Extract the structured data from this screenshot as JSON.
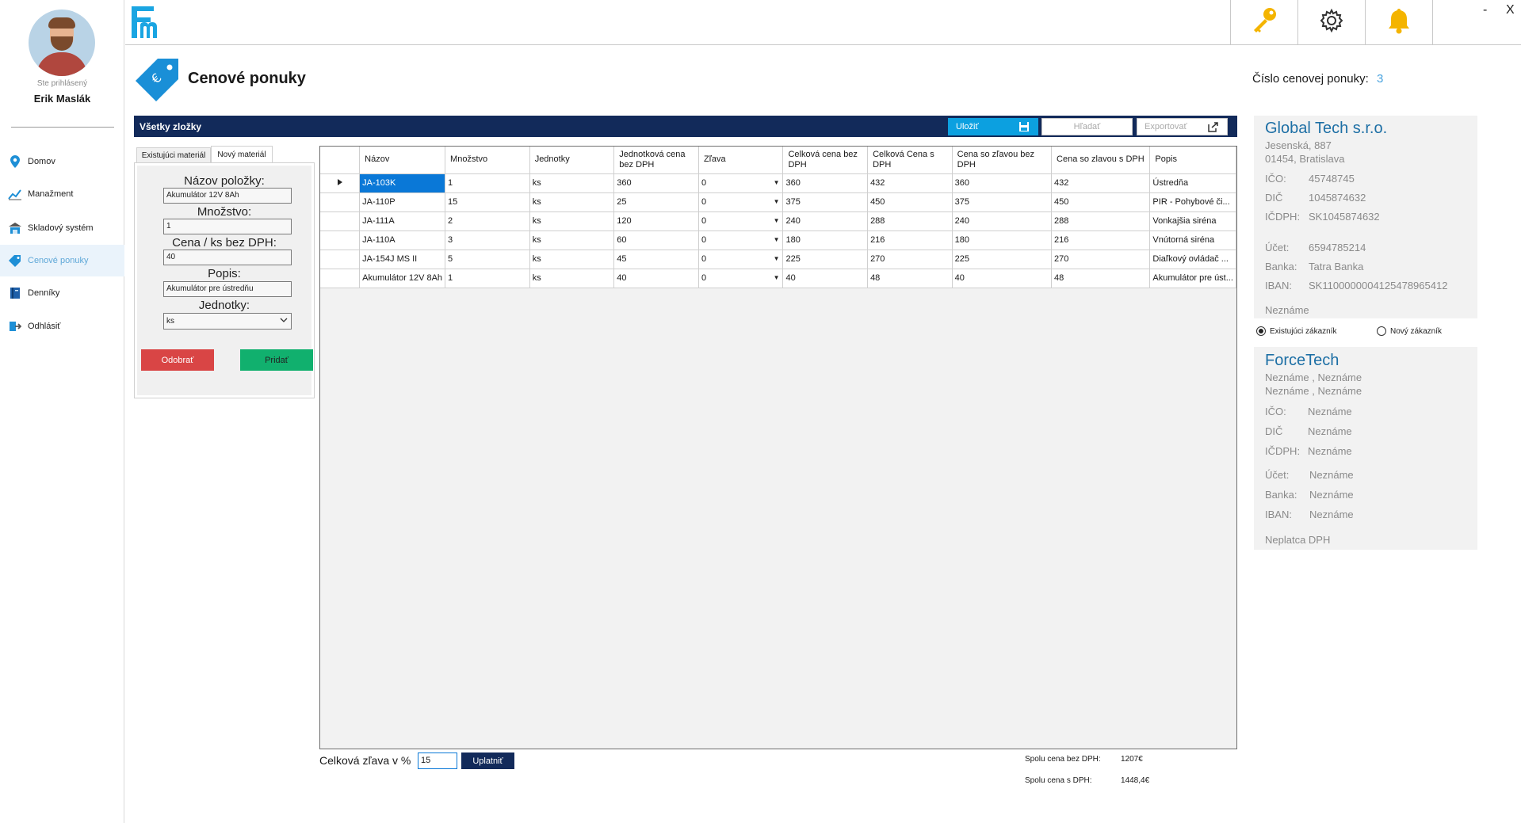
{
  "user": {
    "logged_label": "Ste prihlásený",
    "name": "Erik Maslák"
  },
  "nav": [
    {
      "label": "Domov",
      "icon": "map-pin-icon"
    },
    {
      "label": "Manažment",
      "icon": "chart-icon"
    },
    {
      "label": "Skladový systém",
      "icon": "warehouse-icon"
    },
    {
      "label": "Cenové ponuky",
      "icon": "price-tag-icon",
      "active": true
    },
    {
      "label": "Denníky",
      "icon": "book-icon"
    },
    {
      "label": "Odhlásiť",
      "icon": "logout-icon"
    }
  ],
  "topbar": {
    "icons": [
      "key-icon",
      "gear-icon",
      "bell-icon"
    ],
    "minimize": "-",
    "close": "X"
  },
  "header": {
    "title": "Cenové ponuky",
    "offer_number_label": "Číslo cenovej ponuky:",
    "offer_number": "3"
  },
  "toolbar": {
    "title": "Všetky zložky",
    "save_label": "Uložiť",
    "search_label": "Hľadať",
    "export_label": "Exportovať"
  },
  "form": {
    "tabs": [
      "Existujúci materiál",
      "Nový materiál"
    ],
    "active_tab": 1,
    "name_label": "Názov položky:",
    "name_value": "Akumulátor 12V 8Ah",
    "qty_label": "Množstvo:",
    "qty_value": "1",
    "price_label": "Cena / ks bez DPH:",
    "price_value": "40",
    "desc_label": "Popis:",
    "desc_value": "Akumulátor pre ústredňu",
    "unit_label": "Jednotky:",
    "unit_value": "ks",
    "remove_label": "Odobrať",
    "add_label": "Pridať"
  },
  "table": {
    "columns": [
      "Názov",
      "Množstvo",
      "Jednotky",
      "Jednotková cena bez DPH",
      "Zľava",
      "Celková cena bez DPH",
      "Celková Cena s DPH",
      "Cena so zľavou bez DPH",
      "Cena so zlavou s DPH",
      "Popis"
    ],
    "rows": [
      [
        "JA-103K",
        "1",
        "ks",
        "360",
        "0",
        "360",
        "432",
        "360",
        "432",
        "Ústredňa"
      ],
      [
        "JA-110P",
        "15",
        "ks",
        "25",
        "0",
        "375",
        "450",
        "375",
        "450",
        "PIR - Pohybové či..."
      ],
      [
        "JA-111A",
        "2",
        "ks",
        "120",
        "0",
        "240",
        "288",
        "240",
        "288",
        "Vonkajšia siréna"
      ],
      [
        "JA-110A",
        "3",
        "ks",
        "60",
        "0",
        "180",
        "216",
        "180",
        "216",
        "Vnútorná siréna"
      ],
      [
        "JA-154J MS II",
        "5",
        "ks",
        "45",
        "0",
        "225",
        "270",
        "225",
        "270",
        "Diaľkový ovládač ..."
      ],
      [
        "Akumulátor 12V 8Ah",
        "1",
        "ks",
        "40",
        "0",
        "40",
        "48",
        "40",
        "48",
        "Akumulátor pre úst..."
      ]
    ]
  },
  "footer": {
    "discount_label": "Celková zľava v %",
    "discount_value": "15",
    "apply_label": "Uplatniť",
    "total_net_label": "Spolu cena bez DPH:",
    "total_net": "1207€",
    "total_gross_label": "Spolu cena s DPH:",
    "total_gross": "1448,4€"
  },
  "supplier": {
    "name": "Global Tech s.r.o.",
    "street": "Jesenská, 887",
    "city": "01454, Bratislava",
    "ico_label": "IČO:",
    "ico": "45748745",
    "dic_label": "DIČ",
    "dic": "1045874632",
    "icdph_label": "IČDPH:",
    "icdph": "SK1045874632",
    "account_label": "Účet:",
    "account": "6594785214",
    "bank_label": "Banka:",
    "bank": "Tatra Banka",
    "iban_label": "IBAN:",
    "iban": "SK1100000004125478965412",
    "vat_status": "Neznáme"
  },
  "customer_mode": {
    "existing_label": "Existujúci zákazník",
    "new_label": "Nový zákazník",
    "selected": "existing"
  },
  "customer": {
    "name": "ForceTech",
    "line1": "Neznáme , Neznáme",
    "line2": "Neznáme , Neznáme",
    "ico_label": "IČO:",
    "ico": "Neznáme",
    "dic_label": "DIČ",
    "dic": "Neznáme",
    "icdph_label": "IČDPH:",
    "icdph": "Neznáme",
    "account_label": "Účet:",
    "account": "Neznáme",
    "bank_label": "Banka:",
    "bank": "Neznáme",
    "iban_label": "IBAN:",
    "iban": "Neznáme",
    "vat_status": "Neplatca DPH"
  },
  "colors": {
    "accent": "#0ca0e0",
    "navy": "#122a5a",
    "remove": "#d94545",
    "add": "#11b06e",
    "selected_cell": "#0a78d7",
    "brand_name": "#1d6fa5"
  }
}
